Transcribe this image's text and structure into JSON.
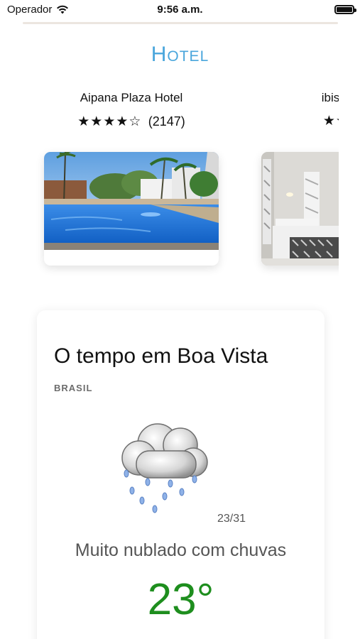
{
  "status_bar": {
    "carrier": "Operador",
    "time": "9:56 a.m."
  },
  "section_title": "Hotel",
  "hotels": [
    {
      "name": "Aipana Plaza Hotel",
      "stars": "★★★★☆",
      "rating": 4.5,
      "reviews": "(2147)",
      "image": "pool-photo"
    },
    {
      "name": "ibis Styles",
      "stars": "★★★★",
      "image": "room-photo"
    }
  ],
  "weather": {
    "title": "O tempo em Boa Vista",
    "country": "BRASIL",
    "icon": "cloud-rain-icon",
    "date": "23/31",
    "description": "Muito nublado com chuvas",
    "temperature": "23°",
    "temperature_color": "#1e8e1e"
  },
  "colors": {
    "accent": "#4aa6dc"
  }
}
